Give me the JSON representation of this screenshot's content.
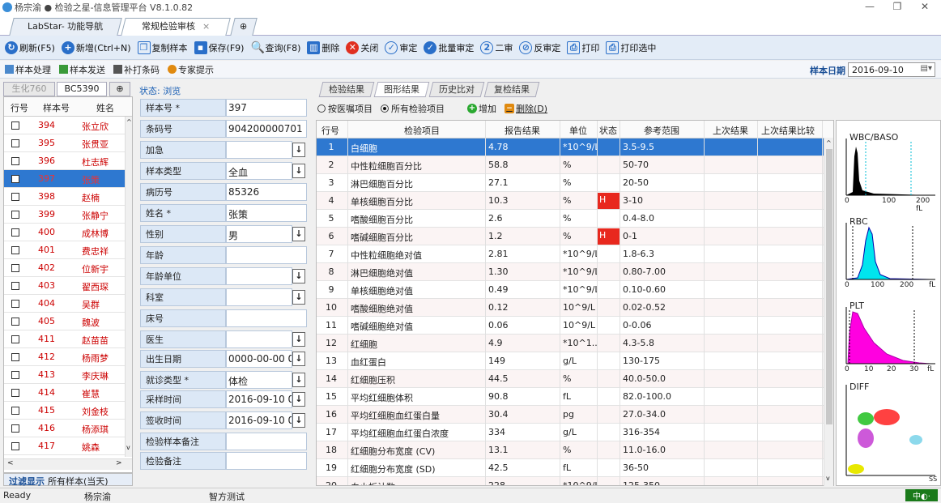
{
  "window": {
    "title": "杨宗渝 ● 检验之星-信息管理平台 V8.1.0.82"
  },
  "doc_tabs": [
    {
      "label": "LabStar- 功能导航"
    },
    {
      "label": "常规检验审核"
    }
  ],
  "toolbar": [
    {
      "label": "刷新(F5)",
      "icon": "refresh-icon"
    },
    {
      "label": "新增(Ctrl+N)",
      "icon": "add-icon"
    },
    {
      "label": "复制样本",
      "icon": "copy-icon"
    },
    {
      "label": "保存(F9)",
      "icon": "save-icon"
    },
    {
      "label": "查询(F8)",
      "icon": "search-icon"
    },
    {
      "label": "删除",
      "icon": "delete-icon"
    },
    {
      "label": "关闭",
      "icon": "close-icon"
    },
    {
      "label": "审定",
      "icon": "approve-icon"
    },
    {
      "label": "批量审定",
      "icon": "batch-approve-icon"
    },
    {
      "label": "二审",
      "icon": "second-review-icon"
    },
    {
      "label": "反审定",
      "icon": "unapprove-icon"
    },
    {
      "label": "打印",
      "icon": "print-icon"
    },
    {
      "label": "打印选中",
      "icon": "print-selected-icon"
    }
  ],
  "subbar": {
    "items": [
      "样本处理",
      "样本发送",
      "补打条码",
      "专家提示"
    ],
    "date_label": "样本日期",
    "date_value": "2016-09-10"
  },
  "left": {
    "tabs": [
      "生化760",
      "BC5390"
    ],
    "headers": [
      "行号",
      "样本号",
      "姓名"
    ],
    "rows": [
      {
        "no": "394",
        "name": "张立欣"
      },
      {
        "no": "395",
        "name": "张贯亚"
      },
      {
        "no": "396",
        "name": "杜志辉"
      },
      {
        "no": "397",
        "name": "张策"
      },
      {
        "no": "398",
        "name": "赵楠"
      },
      {
        "no": "399",
        "name": "张静宁"
      },
      {
        "no": "400",
        "name": "成林博"
      },
      {
        "no": "401",
        "name": "费忠祥"
      },
      {
        "no": "402",
        "name": "位新宇"
      },
      {
        "no": "403",
        "name": "翟西琛"
      },
      {
        "no": "404",
        "name": "吴群"
      },
      {
        "no": "405",
        "name": "魏波"
      },
      {
        "no": "411",
        "name": "赵苗苗"
      },
      {
        "no": "412",
        "name": "杨雨梦"
      },
      {
        "no": "413",
        "name": "李庆琳"
      },
      {
        "no": "414",
        "name": "崔慧"
      },
      {
        "no": "415",
        "name": "刘金枝"
      },
      {
        "no": "416",
        "name": "杨添琪"
      },
      {
        "no": "417",
        "name": "姚森"
      }
    ],
    "selected_index": 3,
    "filter_label": "过滤显示",
    "filter_value": "所有样本(当天)"
  },
  "form": {
    "status": "状态: 浏览",
    "fields": [
      {
        "label": "样本号 *",
        "value": "397",
        "dropdown": false
      },
      {
        "label": "条码号",
        "value": "904200000701",
        "dropdown": false
      },
      {
        "label": "加急",
        "value": "",
        "dropdown": true
      },
      {
        "label": "样本类型",
        "value": "全血",
        "dropdown": true
      },
      {
        "label": "病历号",
        "value": "85326",
        "dropdown": false
      },
      {
        "label": "姓名 *",
        "value": "张策",
        "dropdown": false
      },
      {
        "label": "性别",
        "value": "男",
        "dropdown": true
      },
      {
        "label": "年龄",
        "value": "",
        "dropdown": false
      },
      {
        "label": "年龄单位",
        "value": "",
        "dropdown": true
      },
      {
        "label": "科室",
        "value": "",
        "dropdown": true
      },
      {
        "label": "床号",
        "value": "",
        "dropdown": false
      },
      {
        "label": "医生",
        "value": "",
        "dropdown": true
      },
      {
        "label": "出生日期",
        "value": "0000-00-00 00",
        "dropdown": true
      },
      {
        "label": "就诊类型 *",
        "value": "体检",
        "dropdown": true
      },
      {
        "label": "采样时间",
        "value": "2016-09-10 00",
        "dropdown": true
      },
      {
        "label": "签收时间",
        "value": "2016-09-10 00",
        "dropdown": true
      },
      {
        "label": "检验样本备注",
        "value": "",
        "dropdown": false
      },
      {
        "label": "检验备注",
        "value": "",
        "dropdown": false
      }
    ]
  },
  "right": {
    "tabs": [
      "检验结果",
      "图形结果",
      "历史比对",
      "复检结果"
    ],
    "radio1": "按医嘱项目",
    "radio2": "所有检验项目",
    "add_label": "增加",
    "delete_label": "删除(D)",
    "headers": [
      "行号",
      "检验项目",
      "报告结果",
      "单位",
      "状态",
      "参考范围",
      "上次结果",
      "上次结果比较"
    ],
    "rows": [
      {
        "n": "1",
        "item": "白细胞",
        "result": "4.78",
        "unit": "*10^9/L",
        "flag": "",
        "range": "3.5-9.5"
      },
      {
        "n": "2",
        "item": "中性粒细胞百分比",
        "result": "58.8",
        "unit": "%",
        "flag": "",
        "range": "50-70"
      },
      {
        "n": "3",
        "item": "淋巴细胞百分比",
        "result": "27.1",
        "unit": "%",
        "flag": "",
        "range": "20-50"
      },
      {
        "n": "4",
        "item": "单核细胞百分比",
        "result": "10.3",
        "unit": "%",
        "flag": "H",
        "range": "3-10"
      },
      {
        "n": "5",
        "item": "嗜酸细胞百分比",
        "result": "2.6",
        "unit": "%",
        "flag": "",
        "range": "0.4-8.0"
      },
      {
        "n": "6",
        "item": "嗜碱细胞百分比",
        "result": "1.2",
        "unit": "%",
        "flag": "H",
        "range": "0-1"
      },
      {
        "n": "7",
        "item": "中性粒细胞绝对值",
        "result": "2.81",
        "unit": "*10^9/L",
        "flag": "",
        "range": "1.8-6.3"
      },
      {
        "n": "8",
        "item": "淋巴细胞绝对值",
        "result": "1.30",
        "unit": "*10^9/L",
        "flag": "",
        "range": "0.80-7.00"
      },
      {
        "n": "9",
        "item": "单核细胞绝对值",
        "result": "0.49",
        "unit": "*10^9/L",
        "flag": "",
        "range": "0.10-0.60"
      },
      {
        "n": "10",
        "item": "嗜酸细胞绝对值",
        "result": "0.12",
        "unit": "10^9/L",
        "flag": "",
        "range": "0.02-0.52"
      },
      {
        "n": "11",
        "item": "嗜碱细胞绝对值",
        "result": "0.06",
        "unit": "10^9/L",
        "flag": "",
        "range": "0-0.06"
      },
      {
        "n": "12",
        "item": "红细胞",
        "result": "4.9",
        "unit": "*10^1...",
        "flag": "",
        "range": "4.3-5.8"
      },
      {
        "n": "13",
        "item": "血红蛋白",
        "result": "149",
        "unit": "g/L",
        "flag": "",
        "range": "130-175"
      },
      {
        "n": "14",
        "item": "红细胞压积",
        "result": "44.5",
        "unit": "%",
        "flag": "",
        "range": "40.0-50.0"
      },
      {
        "n": "15",
        "item": "平均红细胞体积",
        "result": "90.8",
        "unit": "fL",
        "flag": "",
        "range": "82.0-100.0"
      },
      {
        "n": "16",
        "item": "平均红细胞血红蛋白量",
        "result": "30.4",
        "unit": "pg",
        "flag": "",
        "range": "27.0-34.0"
      },
      {
        "n": "17",
        "item": "平均红细胞血红蛋白浓度",
        "result": "334",
        "unit": "g/L",
        "flag": "",
        "range": "316-354"
      },
      {
        "n": "18",
        "item": "红细胞分布宽度 (CV)",
        "result": "13.1",
        "unit": "%",
        "flag": "",
        "range": "11.0-16.0"
      },
      {
        "n": "19",
        "item": "红细胞分布宽度 (SD)",
        "result": "42.5",
        "unit": "fL",
        "flag": "",
        "range": "36-50"
      },
      {
        "n": "20",
        "item": "血小板计数",
        "result": "228",
        "unit": "*10^9/L",
        "flag": "",
        "range": "125-350"
      }
    ],
    "selected_index": 0
  },
  "histograms": [
    {
      "label": "WBC/BASO",
      "ticks": [
        "0",
        "100",
        "200 fL"
      ],
      "color": "#000000"
    },
    {
      "label": "RBC",
      "ticks": [
        "0",
        "100",
        "200",
        "fL"
      ],
      "color": "#00e5ee"
    },
    {
      "label": "PLT",
      "ticks": [
        "0",
        "10",
        "20",
        "30",
        "fL"
      ],
      "color": "#ff00e0"
    },
    {
      "label": "DIFF",
      "ticks": [
        "SS"
      ],
      "color": "#00c000"
    }
  ],
  "statusbar": {
    "ready": "Ready",
    "user": "杨宗渝",
    "org": "智方测试"
  }
}
